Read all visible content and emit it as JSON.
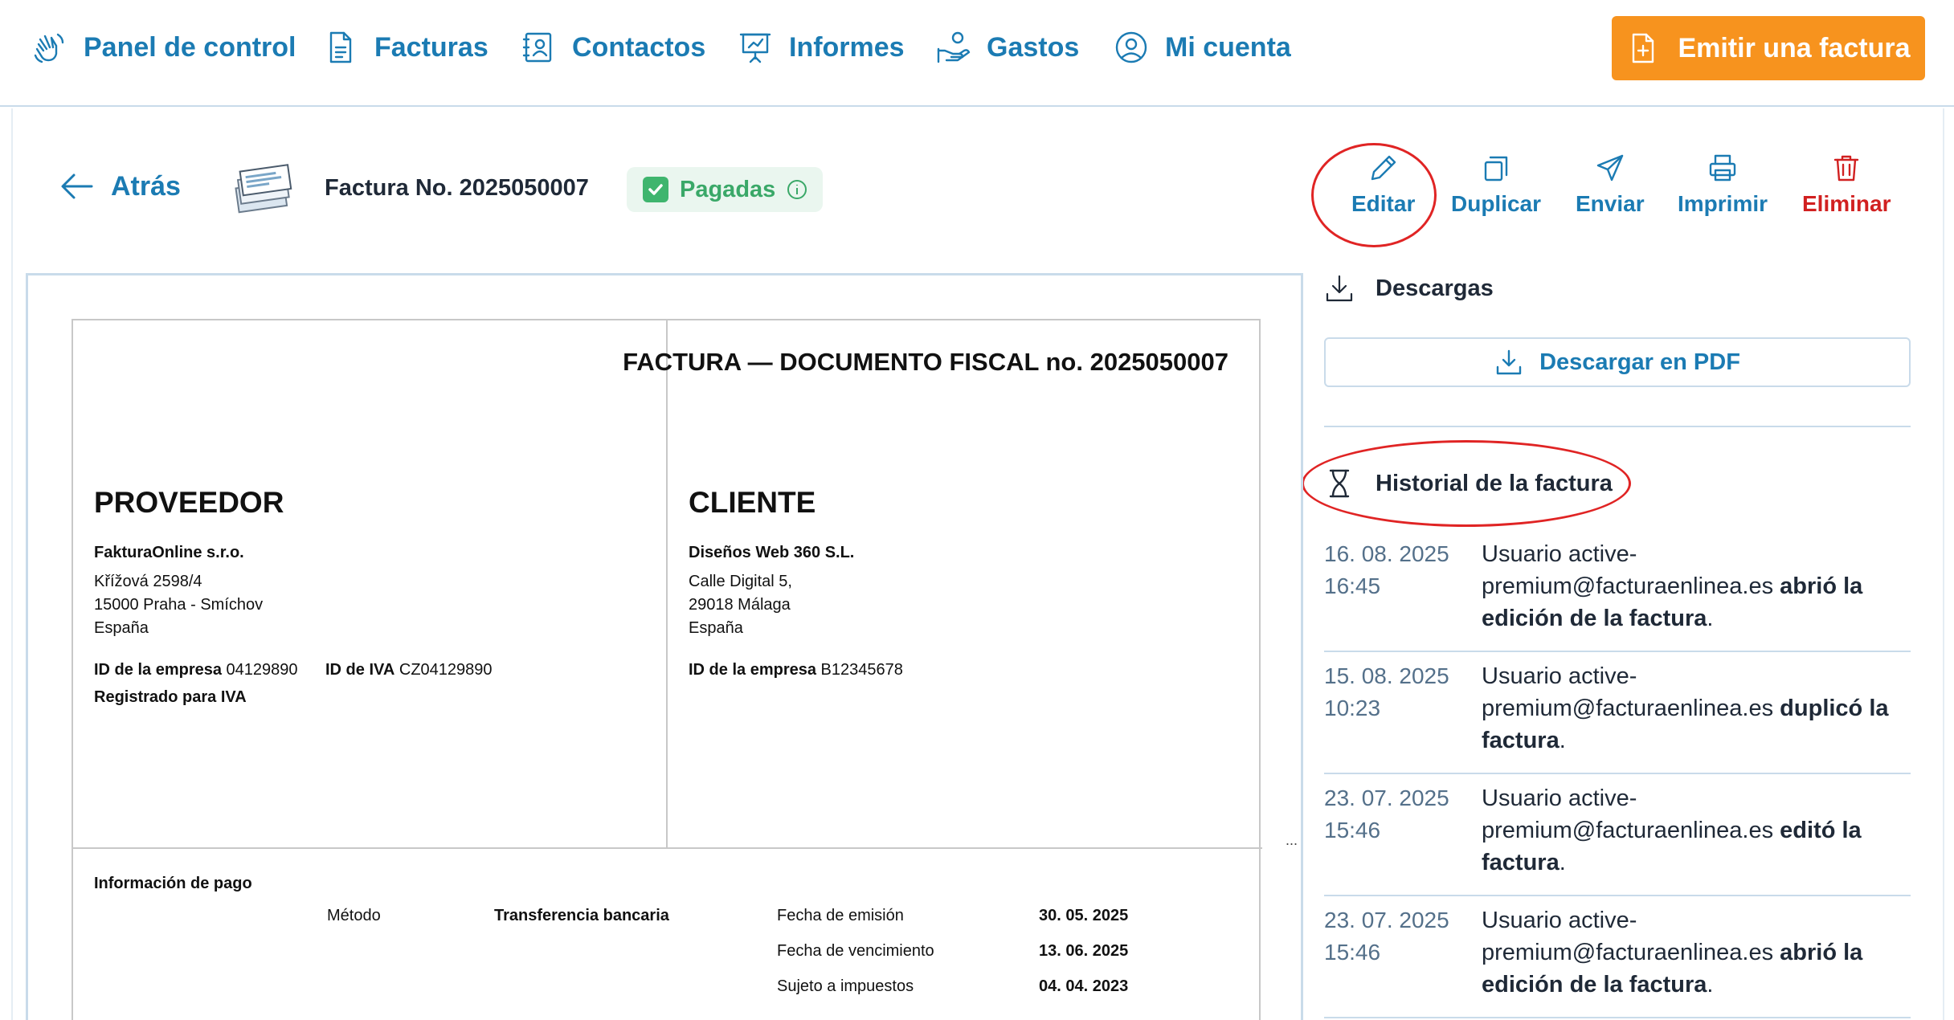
{
  "nav": {
    "items": [
      {
        "label": "Panel de control",
        "icon": "hand-wave-icon"
      },
      {
        "label": "Facturas",
        "icon": "document-icon"
      },
      {
        "label": "Contactos",
        "icon": "contact-card-icon"
      },
      {
        "label": "Informes",
        "icon": "presentation-chart-icon"
      },
      {
        "label": "Gastos",
        "icon": "hand-coins-icon"
      },
      {
        "label": "Mi cuenta",
        "icon": "user-circle-icon"
      }
    ],
    "emit_label": "Emitir una factura"
  },
  "header": {
    "back_label": "Atrás",
    "invoice_title": "Factura No. 2025050007",
    "status_label": "Pagadas"
  },
  "actions": {
    "edit": "Editar",
    "duplicate": "Duplicar",
    "send": "Enviar",
    "print": "Imprimir",
    "delete": "Eliminar"
  },
  "document": {
    "title": "FACTURA — DOCUMENTO FISCAL no. 2025050007",
    "supplier": {
      "heading": "PROVEEDOR",
      "name": "FakturaOnline s.r.o.",
      "address1": "Křížová 2598/4",
      "address2": "15000 Praha - Smíchov",
      "country": "España",
      "company_id_label": "ID de la empresa",
      "company_id": "04129890",
      "vat_id_label": "ID de IVA",
      "vat_id": "CZ04129890",
      "vat_registered": "Registrado para IVA"
    },
    "client": {
      "heading": "CLIENTE",
      "name": "Diseños Web 360 S.L.",
      "address1": "Calle Digital 5,",
      "address2": "29018 Málaga",
      "country": "España",
      "company_id_label": "ID de la empresa",
      "company_id": "B12345678"
    },
    "payment": {
      "title": "Información de pago",
      "method_label": "Método",
      "method_value": "Transferencia bancaria",
      "issue_label": "Fecha de emisión",
      "issue_value": "30. 05. 2025",
      "due_label": "Fecha de vencimiento",
      "due_value": "13. 06. 2025",
      "tax_label": "Sujeto a impuestos",
      "tax_value": "04. 04. 2023"
    },
    "ellipsis": "..."
  },
  "downloads": {
    "heading": "Descargas",
    "pdf_label": "Descargar en PDF"
  },
  "history": {
    "heading": "Historial de la factura",
    "entries": [
      {
        "date": "16. 08. 2025",
        "time": "16:45",
        "prefix": "Usuario active-premium@facturaenlinea.es ",
        "action": "abrió la edición de la factura",
        "suffix": "."
      },
      {
        "date": "15. 08. 2025",
        "time": "10:23",
        "prefix": "Usuario active-premium@facturaenlinea.es ",
        "action": "duplicó la factura",
        "suffix": "."
      },
      {
        "date": "23. 07. 2025",
        "time": "15:46",
        "prefix": "Usuario active-premium@facturaenlinea.es ",
        "action": "editó la factura",
        "suffix": "."
      },
      {
        "date": "23. 07. 2025",
        "time": "15:46",
        "prefix": "Usuario active-premium@facturaenlinea.es ",
        "action": "abrió la edición de la factura",
        "suffix": "."
      }
    ]
  },
  "colors": {
    "brand_blue": "#1b7bb3",
    "accent_orange": "#f7931e",
    "paid_green": "#3aa868",
    "danger_red": "#d12020",
    "annotation_red": "#e02424"
  }
}
